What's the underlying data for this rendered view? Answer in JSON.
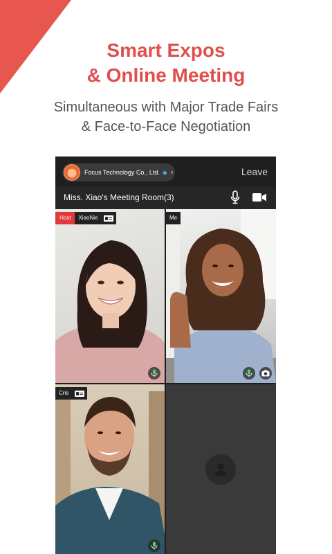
{
  "promo": {
    "title_line1": "Smart Expos",
    "title_line2": "& Online Meeting",
    "subtitle_line1": "Simultaneous with Major Trade Fairs",
    "subtitle_line2": "& Face-to-Face Negotiation",
    "accent_color": "#e04e4e"
  },
  "meeting": {
    "company_name": "Focus Technology Co., Ltd.",
    "company_badge_icon": "diamond-icon",
    "leave_label": "Leave",
    "room_title": "Miss. Xiao's Meeting Room(3)",
    "controls": [
      {
        "icon": "microphone-icon"
      },
      {
        "icon": "video-camera-icon"
      }
    ],
    "participants": [
      {
        "role_badge": "Host",
        "name": "XiaoNie",
        "mic": "mic-on"
      },
      {
        "name": "Me",
        "mic": "mic-on",
        "camera_switch": "camera-switch-icon"
      },
      {
        "name": "Cris",
        "mic": "mic-on"
      },
      {
        "name": "",
        "placeholder_icon": "user-placeholder-icon"
      }
    ]
  }
}
